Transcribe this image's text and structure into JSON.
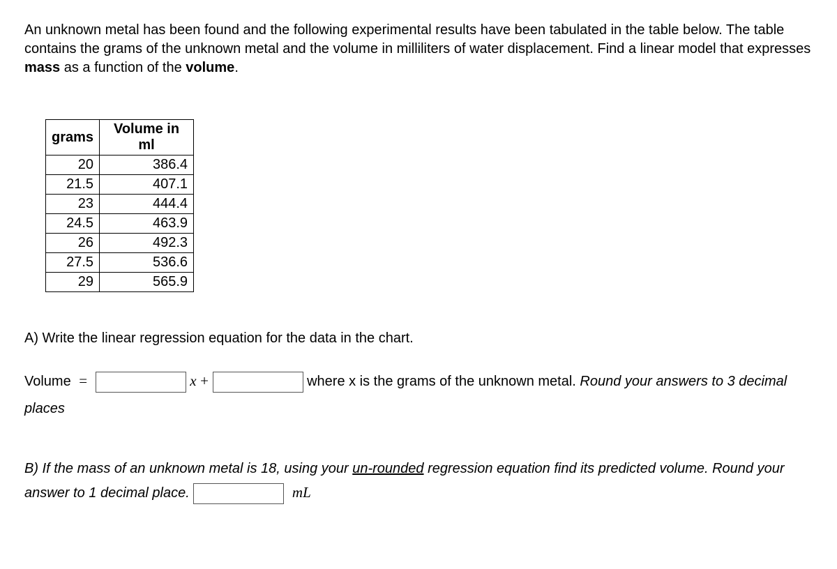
{
  "problem": {
    "intro1": "An unknown metal has been found and the following experimental results have been tabulated in the table below. The table contains the grams of the unknown metal and the volume in milliliters of water displacement. Find a linear model that expresses ",
    "mass": "mass",
    "intro2": " as a function of the ",
    "volume": "volume",
    "intro3": "."
  },
  "table": {
    "header1": "grams",
    "header2": "Volume in ml",
    "rows": [
      {
        "grams": "20",
        "volume": "386.4"
      },
      {
        "grams": "21.5",
        "volume": "407.1"
      },
      {
        "grams": "23",
        "volume": "444.4"
      },
      {
        "grams": "24.5",
        "volume": "463.9"
      },
      {
        "grams": "26",
        "volume": "492.3"
      },
      {
        "grams": "27.5",
        "volume": "536.6"
      },
      {
        "grams": "29",
        "volume": "565.9"
      }
    ]
  },
  "partA": {
    "prompt": "A) Write the linear regression equation for the data in the chart.",
    "volumeLabel": "Volume ",
    "eq": "=",
    "xplus": "x +",
    "tail1": " where x is the grams of the unknown metal. ",
    "round": "Round your answers to 3 decimal places"
  },
  "partB": {
    "line1a": "B)  If the mass of an unknown metal is 18, using your ",
    "underline": "un-rounded",
    "line1b": " regression equation find its predicted volume.  Round your answer to 1 decimal place.  ",
    "mL": "mL"
  }
}
